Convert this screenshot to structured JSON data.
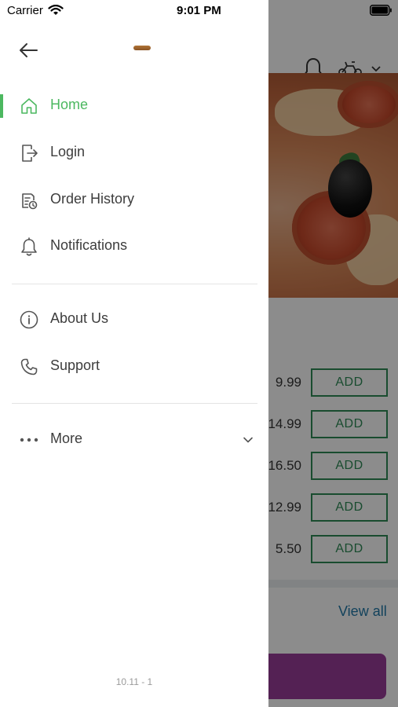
{
  "status_bar": {
    "carrier": "Carrier",
    "time": "9:01 PM"
  },
  "drawer": {
    "menu_primary": [
      {
        "label": "Home",
        "icon": "home-icon",
        "active": true
      },
      {
        "label": "Login",
        "icon": "login-icon",
        "active": false
      },
      {
        "label": "Order History",
        "icon": "receipt-clock-icon",
        "active": false
      },
      {
        "label": "Notifications",
        "icon": "bell-icon",
        "active": false
      }
    ],
    "menu_secondary": [
      {
        "label": "About Us",
        "icon": "info-icon"
      },
      {
        "label": "Support",
        "icon": "phone-icon"
      }
    ],
    "more": {
      "label": "More",
      "icon": "more-dots-icon"
    },
    "version": "10.11 - 1"
  },
  "background": {
    "prices": [
      "9.99",
      "14.99",
      "16.50",
      "12.99",
      "5.50"
    ],
    "add_label": "ADD",
    "view_all": "View all"
  },
  "colors": {
    "accent_green": "#4cb860",
    "add_button_green": "#2e8a57",
    "link_blue": "#2279a8",
    "checkout_purple": "#9a3d99"
  }
}
